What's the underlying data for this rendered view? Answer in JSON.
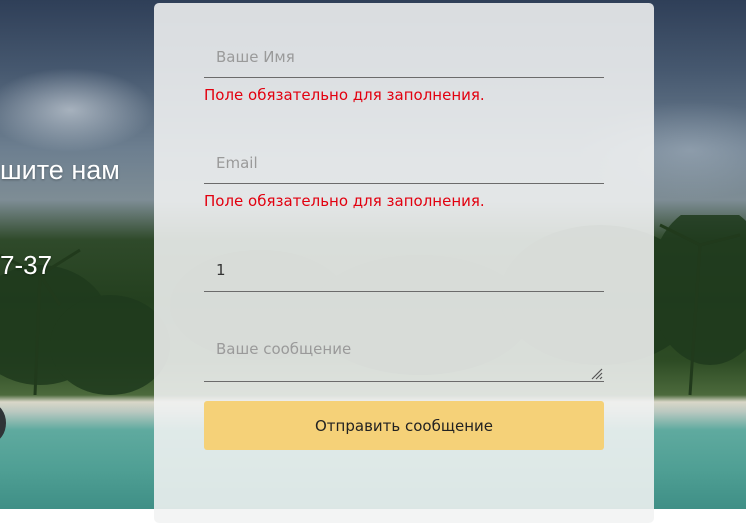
{
  "background": {
    "left_text_line1": "шите нам",
    "left_text_line2": "7-37"
  },
  "form": {
    "name": {
      "placeholder": "Ваше Имя",
      "value": "",
      "error": "Поле обязательно для заполнения."
    },
    "email": {
      "placeholder": "Email",
      "value": "",
      "error": "Поле обязательно для заполнения."
    },
    "phone": {
      "value": "1"
    },
    "message": {
      "placeholder": "Ваше сообщение",
      "value": ""
    },
    "submit_label": "Отправить сообщение"
  },
  "colors": {
    "error": "#e2000f",
    "button": "#f5d178",
    "card": "#f1f2f3"
  }
}
